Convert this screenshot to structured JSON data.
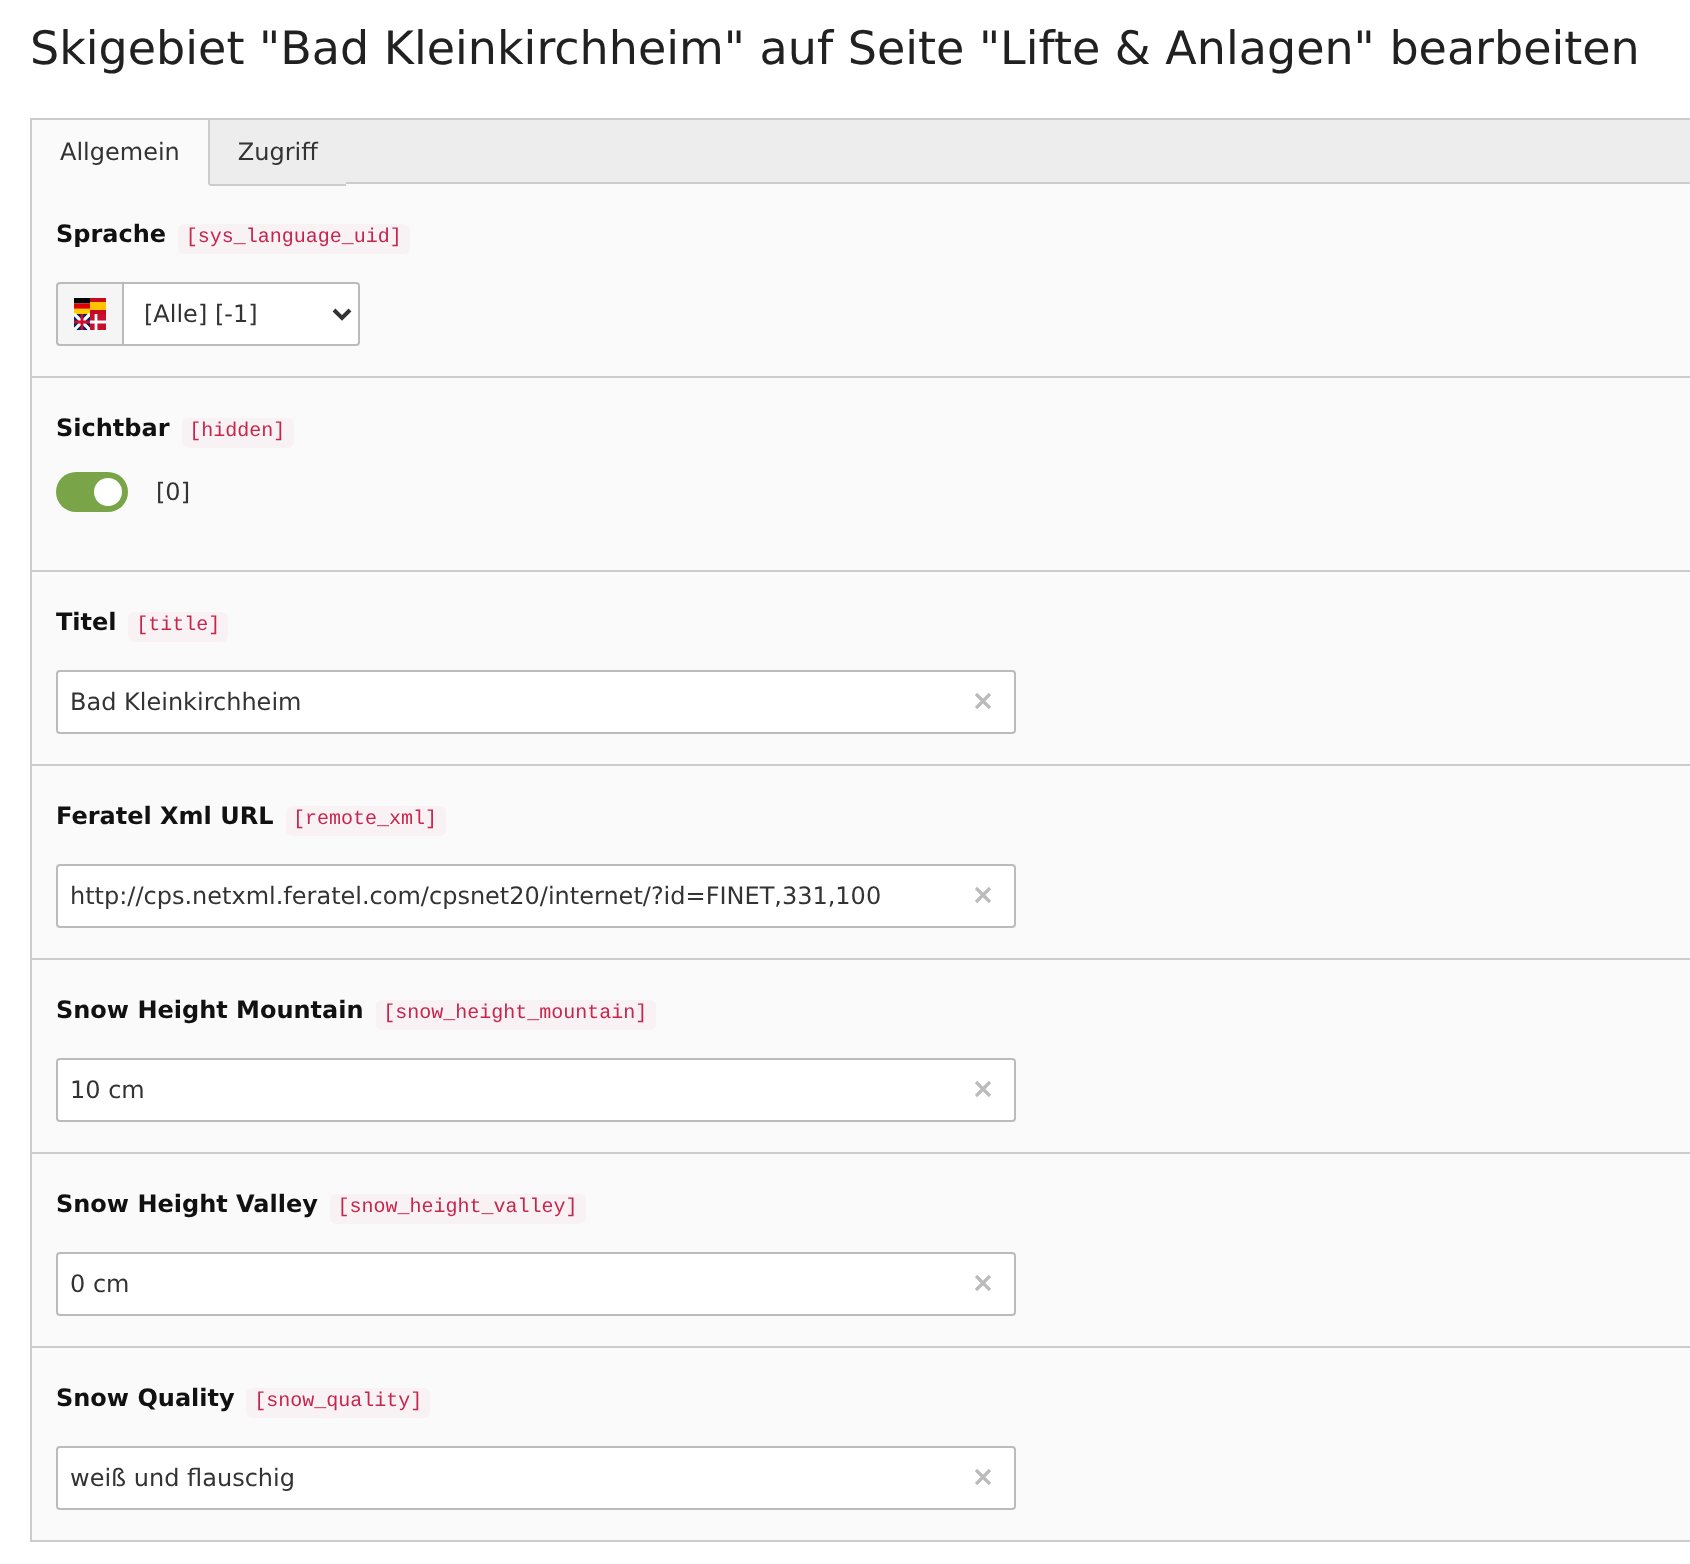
{
  "title": "Skigebiet \"Bad Kleinkirchheim\" auf Seite \"Lifte & Anlagen\" bearbeiten",
  "tabs": [
    {
      "label": "Allgemein",
      "selected": true
    },
    {
      "label": "Zugriff",
      "selected": false
    }
  ],
  "fields": [
    {
      "kind": "select",
      "label": "Sprache",
      "key": "[sys_language_uid]",
      "value": "[Alle] [-1]"
    },
    {
      "kind": "toggle",
      "label": "Sichtbar",
      "key": "[hidden]",
      "on": true,
      "value": "[0]"
    },
    {
      "kind": "text",
      "label": "Titel",
      "key": "[title]",
      "value": "Bad Kleinkirchheim"
    },
    {
      "kind": "text",
      "label": "Feratel Xml URL",
      "key": "[remote_xml]",
      "value": "http://cps.netxml.feratel.com/cpsnet20/internet/?id=FINET,331,100"
    },
    {
      "kind": "text",
      "label": "Snow Height Mountain",
      "key": "[snow_height_mountain]",
      "value": "10 cm"
    },
    {
      "kind": "text",
      "label": "Snow Height Valley",
      "key": "[snow_height_valley]",
      "value": "0 cm"
    },
    {
      "kind": "text",
      "label": "Snow Quality",
      "key": "[snow_quality]",
      "value": "weiß und flauschig"
    }
  ]
}
